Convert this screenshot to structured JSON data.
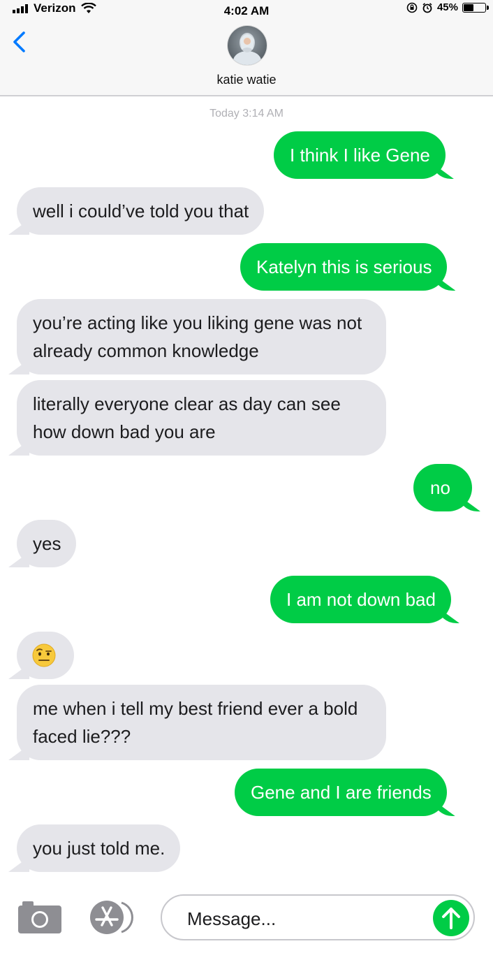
{
  "status_bar": {
    "carrier": "Verizon",
    "time": "4:02 AM",
    "battery_percent": "45%",
    "battery_level": 0.45,
    "icons": [
      "signal-bars-icon",
      "wifi-icon",
      "orientation-lock-icon",
      "alarm-icon",
      "battery-icon"
    ]
  },
  "header": {
    "back_icon": "chevron-left-icon",
    "contact_name": "katie watie",
    "avatar": "contact-avatar"
  },
  "conversation": {
    "timestamp": "Today 3:14 AM",
    "messages": [
      {
        "dir": "out",
        "text": "I think I like Gene"
      },
      {
        "dir": "in",
        "text": "well i could’ve told you that"
      },
      {
        "dir": "out",
        "text": "Katelyn this is serious"
      },
      {
        "dir": "in",
        "text": "you’re acting like you liking gene was not already common knowledge"
      },
      {
        "dir": "in",
        "text": "literally everyone clear as day can see how down bad you are"
      },
      {
        "dir": "out",
        "text": "no"
      },
      {
        "dir": "in",
        "text": "yes"
      },
      {
        "dir": "out",
        "text": "I am not down bad"
      },
      {
        "dir": "in",
        "text": "",
        "emoji": "face-with-raised-eyebrow-icon"
      },
      {
        "dir": "in",
        "text": "me when i tell my best friend ever a bold faced lie???"
      },
      {
        "dir": "out",
        "text": "Gene and I are friends"
      },
      {
        "dir": "in",
        "text": "you just told me."
      }
    ]
  },
  "input_bar": {
    "camera_icon": "camera-icon",
    "apps_icon": "app-store-icon",
    "placeholder": "Message...",
    "send_icon": "send-arrow-up-icon"
  },
  "colors": {
    "outgoing_bubble": "#00cc46",
    "incoming_bubble": "#e5e5ea",
    "accent_blue": "#007aff"
  }
}
